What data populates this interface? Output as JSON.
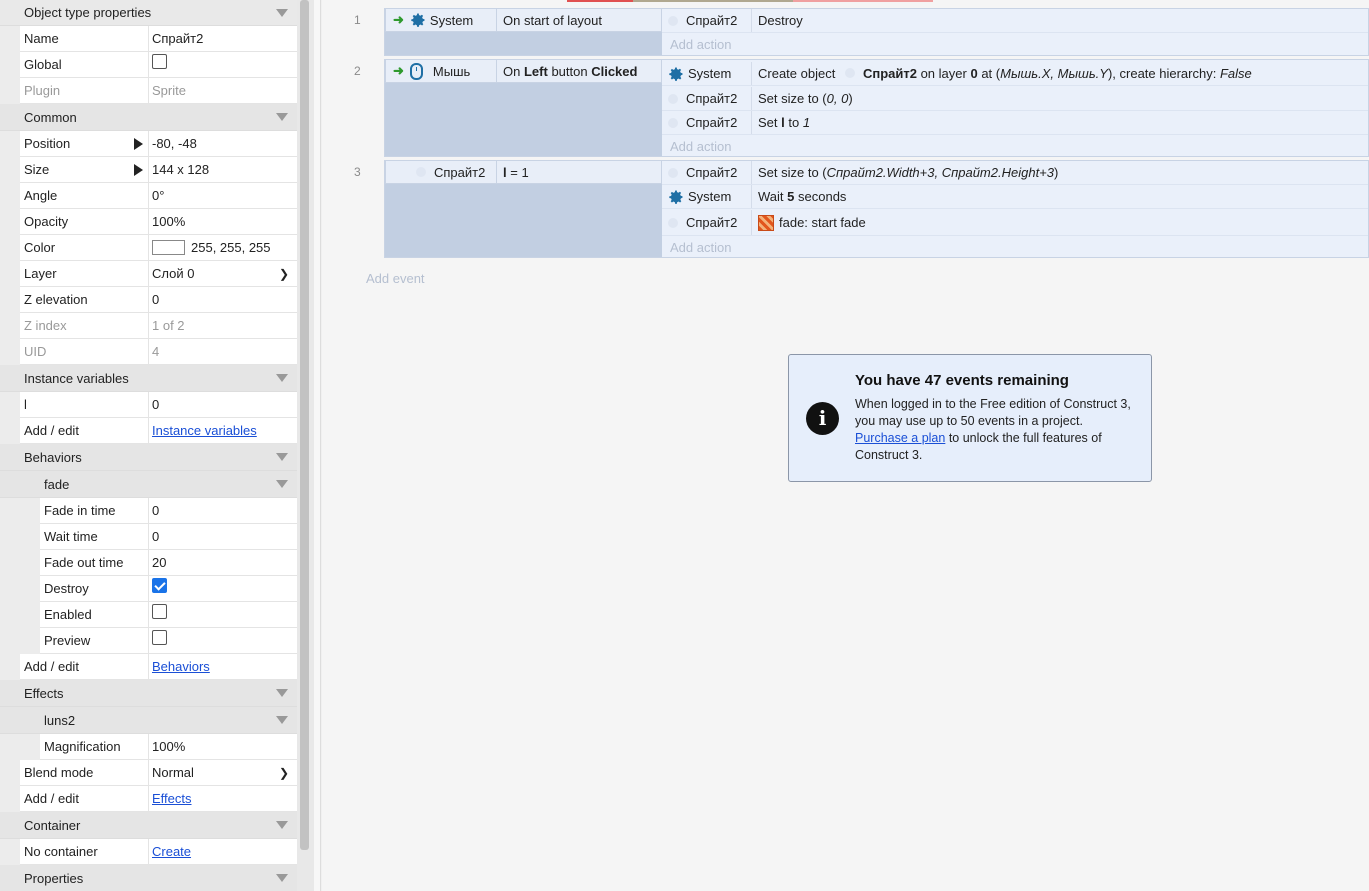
{
  "props": {
    "header": "Object type properties",
    "name_label": "Name",
    "name_value": "Спрайт2",
    "global_label": "Global",
    "plugin_label": "Plugin",
    "plugin_value": "Sprite",
    "common_header": "Common",
    "position_label": "Position",
    "position_value": "-80, -48",
    "size_label": "Size",
    "size_value": "144 x 128",
    "angle_label": "Angle",
    "angle_value": "0°",
    "opacity_label": "Opacity",
    "opacity_value": "100%",
    "color_label": "Color",
    "color_value": "255, 255, 255",
    "layer_label": "Layer",
    "layer_value": "Слой 0",
    "zelev_label": "Z elevation",
    "zelev_value": "0",
    "zindex_label": "Z index",
    "zindex_value": "1 of 2",
    "uid_label": "UID",
    "uid_value": "4",
    "instvars_header": "Instance variables",
    "var_l_label": "l",
    "var_l_value": "0",
    "addedit_label": "Add / edit",
    "instvars_link": "Instance variables",
    "behaviors_header": "Behaviors",
    "fade_header": "fade",
    "fadein_label": "Fade in time",
    "fadein_value": "0",
    "wait_label": "Wait time",
    "wait_value": "0",
    "fadeout_label": "Fade out time",
    "fadeout_value": "20",
    "destroy_label": "Destroy",
    "enabled_label": "Enabled",
    "preview_label": "Preview",
    "behaviors_link": "Behaviors",
    "effects_header": "Effects",
    "luns_header": "luns2",
    "magn_label": "Magnification",
    "magn_value": "100%",
    "blend_label": "Blend mode",
    "blend_value": "Normal",
    "effects_link": "Effects",
    "container_header": "Container",
    "nocontainer_label": "No container",
    "create_link": "Create",
    "properties_header": "Properties"
  },
  "events": {
    "e1": {
      "num": "1",
      "cond_obj": "System",
      "cond_text": "On start of layout",
      "a1_obj": "Спрайт2",
      "a1_text": "Destroy",
      "add_action": "Add action"
    },
    "e2": {
      "num": "2",
      "cond_obj": "Мышь",
      "cond_on": "On",
      "cond_left": "Left",
      "cond_button": "button",
      "cond_clicked": "Clicked",
      "a1_obj": "System",
      "a1_t1": "Create object",
      "a1_t2": "Спрайт2",
      "a1_t3": "on layer",
      "a1_t4": "0",
      "a1_t5": "at (",
      "a1_t6": "Мышь.X, Мышь.Y",
      "a1_t7": "), create hierarchy:",
      "a1_t8": "False",
      "a2_obj": "Спрайт2",
      "a2_t1": "Set size to (",
      "a2_t2": "0, 0",
      "a2_t3": ")",
      "a3_obj": "Спрайт2",
      "a3_t1": "Set",
      "a3_t2": "l",
      "a3_t3": "to",
      "a3_t4": "1",
      "add_action": "Add action"
    },
    "e3": {
      "num": "3",
      "cond_obj": "Спрайт2",
      "cond_var": "l",
      "cond_rest": "= 1",
      "a1_obj": "Спрайт2",
      "a1_t1": "Set size to (",
      "a1_t2": "Спрайт2.Width+3, Спрайт2.Height+3",
      "a1_t3": ")",
      "a2_obj": "System",
      "a2_t1": "Wait",
      "a2_t2": "5",
      "a2_t3": "seconds",
      "a3_obj": "Спрайт2",
      "a3_t1": "fade: start fade",
      "add_action": "Add action"
    },
    "add_event": "Add event"
  },
  "notice": {
    "title": "You have 47 events remaining",
    "body1": "When logged in to the Free edition of Construct 3, you may use up to 50 events in a project.",
    "link": "Purchase a plan",
    "body2": "to unlock the full features of Construct 3."
  },
  "icons": {
    "gear": "gear-icon",
    "mouse": "mouse-icon",
    "arrow": "trigger-arrow-icon",
    "fade": "fade-behavior-icon",
    "info": "info-icon"
  },
  "colors": {
    "accent": "#1a73e8",
    "condition_bg": "#e8eef8",
    "event_bg": "#c2cfe2",
    "link": "#1a4fd6"
  }
}
